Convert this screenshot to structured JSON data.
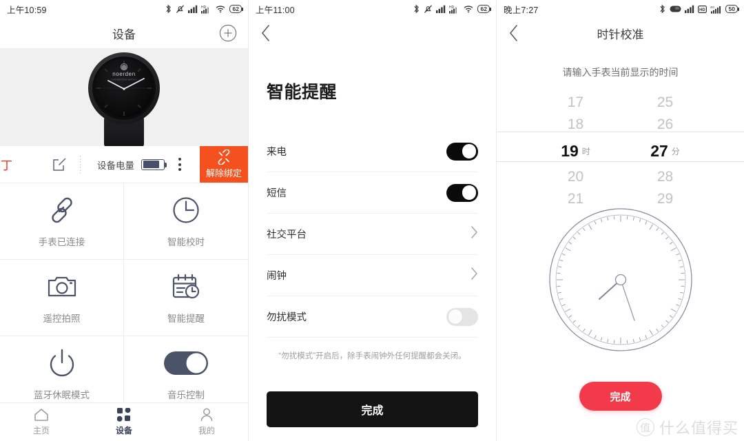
{
  "panels": [
    {
      "status": {
        "time": "上午10:59",
        "battery": "62"
      },
      "nav": {
        "title": "设备",
        "add_icon": "plus-circle-icon"
      },
      "device": {
        "brand": "noerden",
        "toolbar": {
          "red_char": "丁",
          "edit_icon": "edit-square-icon",
          "battery_label": "设备电量",
          "more_icon": "more-vertical-icon",
          "unbind_label": "解除绑定",
          "unbind_icon": "broken-link-icon",
          "unbind_color": "#f4511e"
        }
      },
      "features": [
        {
          "label": "手表已连接",
          "icon": "link-icon"
        },
        {
          "label": "智能校时",
          "icon": "clock-icon"
        },
        {
          "label": "遥控拍照",
          "icon": "camera-icon"
        },
        {
          "label": "智能提醒",
          "icon": "calendar-clock-icon"
        },
        {
          "label": "蓝牙休眠模式",
          "icon": "power-icon"
        },
        {
          "label": "音乐控制",
          "icon": "toggle-on-icon"
        }
      ],
      "tabs": [
        {
          "label": "主页",
          "icon": "home-icon",
          "active": false
        },
        {
          "label": "设备",
          "icon": "grid-icon",
          "active": true
        },
        {
          "label": "我的",
          "icon": "person-icon",
          "active": false
        }
      ]
    },
    {
      "status": {
        "time": "上午11:00",
        "battery": "62"
      },
      "nav": {
        "back_icon": "chevron-left-icon",
        "title": ""
      },
      "title": "智能提醒",
      "settings": [
        {
          "label": "来电",
          "control": "toggle",
          "value": "on"
        },
        {
          "label": "短信",
          "control": "toggle",
          "value": "on"
        },
        {
          "label": "社交平台",
          "control": "chevron"
        },
        {
          "label": "闹钟",
          "control": "chevron"
        },
        {
          "label": "勿扰模式",
          "control": "toggle",
          "value": "off"
        }
      ],
      "note": "“勿扰模式”开启后，除手表闹钟外任何提醒都会关闭。",
      "done_label": "完成"
    },
    {
      "status": {
        "time": "晚上7:27",
        "battery": "50"
      },
      "nav": {
        "back_icon": "chevron-left-icon",
        "title": "时针校准"
      },
      "hint": "请输入手表当前显示的时间",
      "picker": {
        "hours": [
          "17",
          "18",
          "19",
          "20",
          "21"
        ],
        "minutes": [
          "25",
          "26",
          "27",
          "28",
          "29"
        ],
        "selected_hour": "19",
        "selected_minute": "27",
        "hour_unit": "时",
        "minute_unit": "分"
      },
      "dial": {
        "hour_hand_deg": 215,
        "minute_hand_deg": 162
      },
      "done_label": "完成",
      "done_color": "#f23a4b",
      "watermark": {
        "mark": "值",
        "text": "什么值得买"
      }
    }
  ]
}
